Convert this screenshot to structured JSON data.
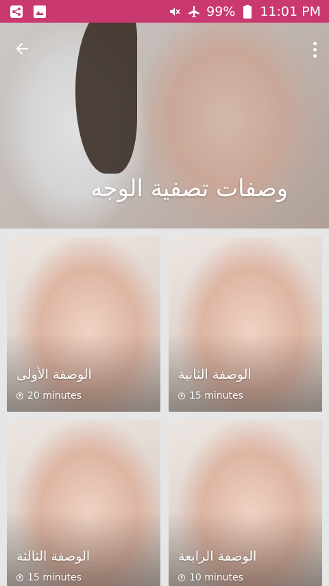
{
  "status_bar": {
    "battery": "99%",
    "time": "11:01 PM",
    "left_icons": [
      "share-icon",
      "image-icon"
    ],
    "right_icons": [
      "mute-icon",
      "airplane-icon",
      "battery-icon"
    ]
  },
  "header": {
    "title": "وصفات تصفية الوجه",
    "back_icon": "arrow-back-icon",
    "menu_icon": "more-vert-icon"
  },
  "recipes": [
    {
      "title": "الوصفة الأولى",
      "duration": "20 minutes"
    },
    {
      "title": "الوصفة الثانية",
      "duration": "15 minutes"
    },
    {
      "title": "الوصفة الثالثة",
      "duration": "15 minutes"
    },
    {
      "title": "الوصفة الرابعة",
      "duration": "10 minutes"
    }
  ],
  "colors": {
    "status_bar": "#c9386f",
    "background": "#e6e6e6"
  }
}
